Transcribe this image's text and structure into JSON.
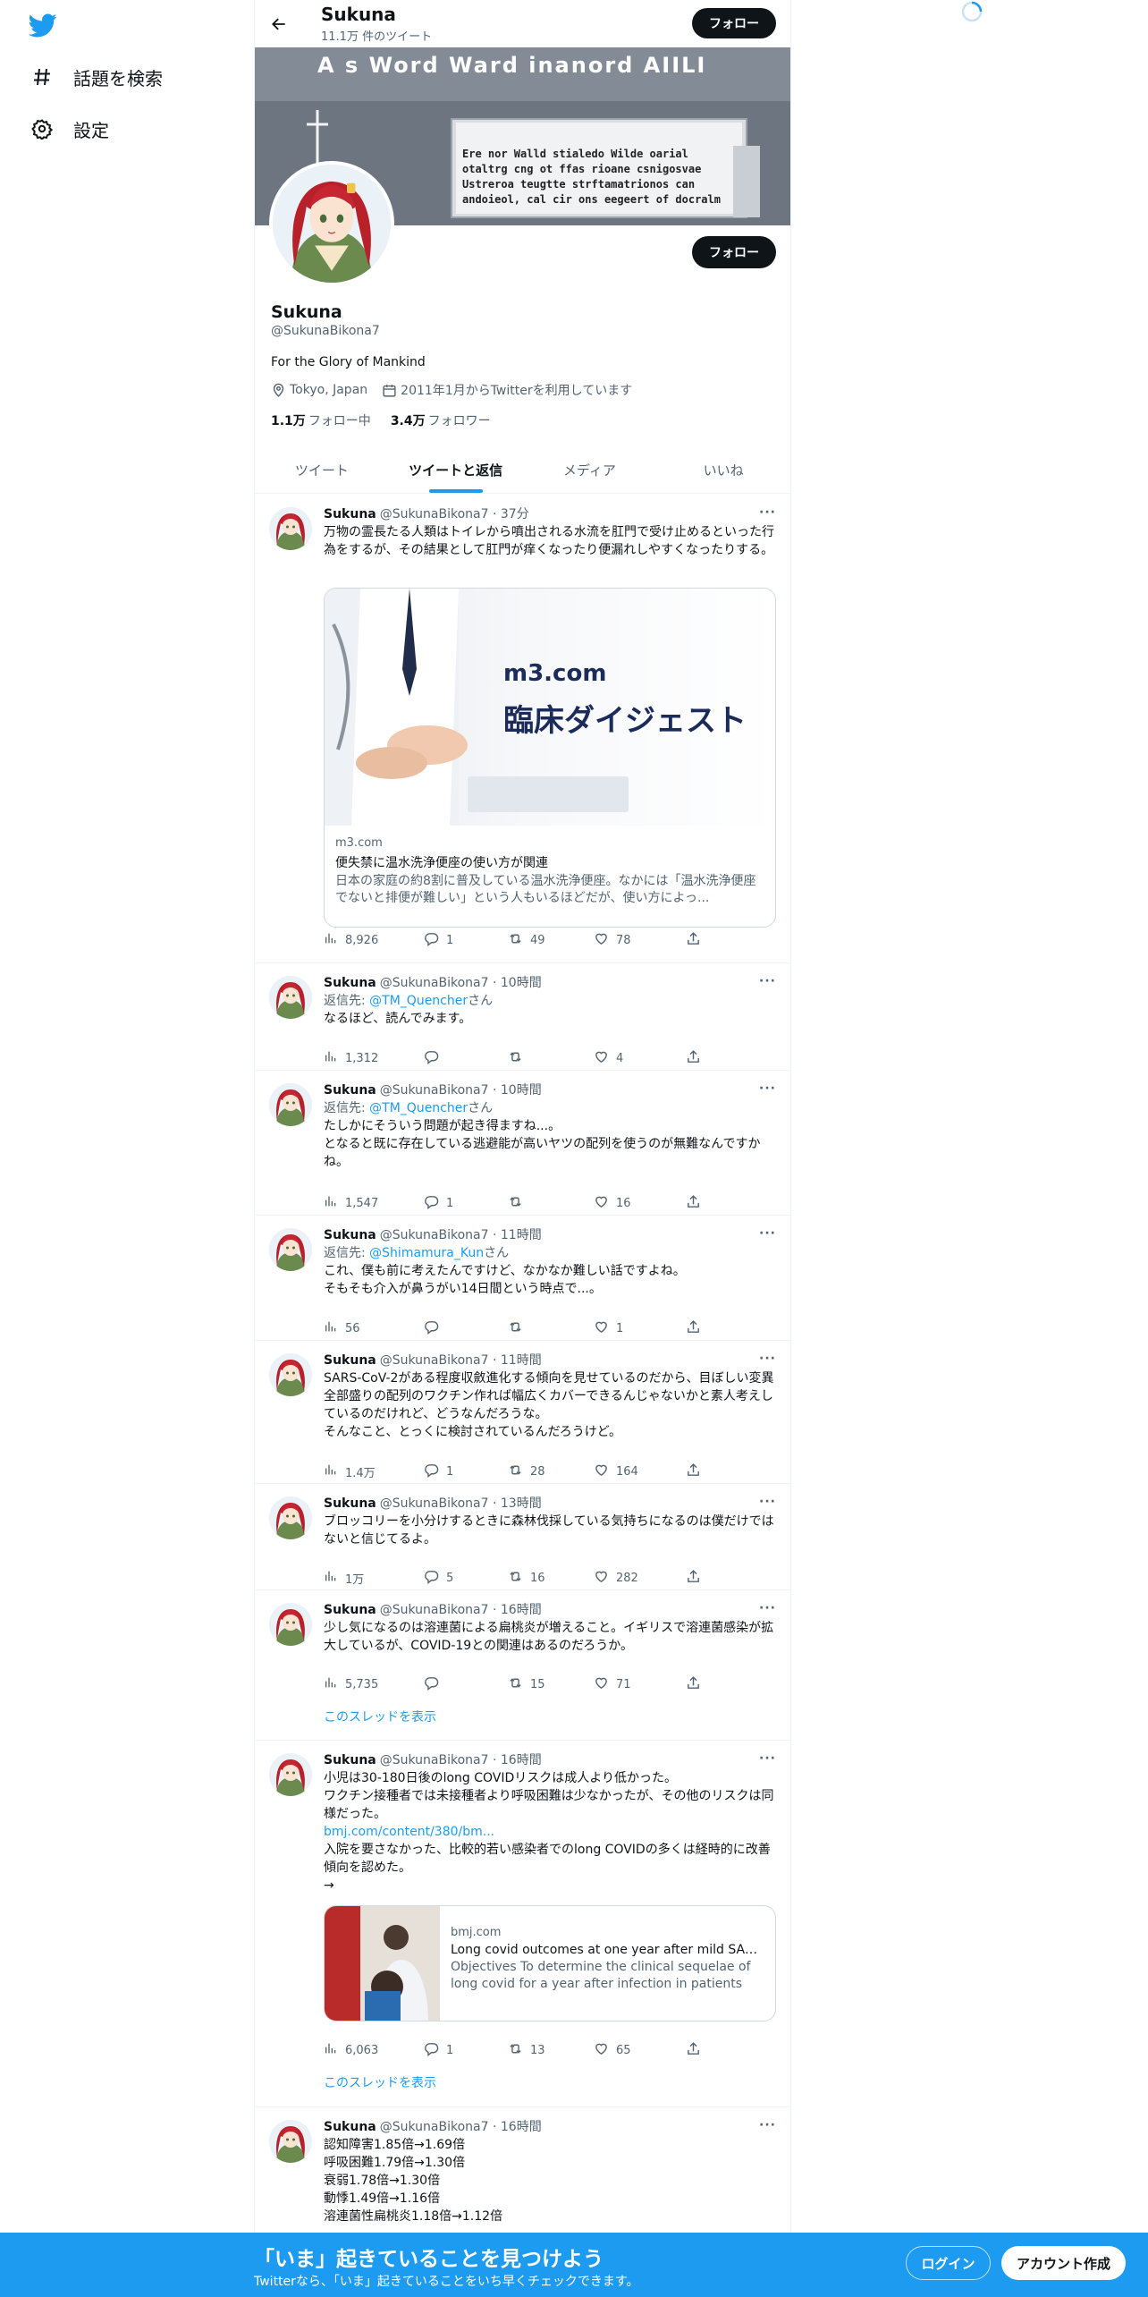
{
  "nav": {
    "explore_label": "話題を検索",
    "settings_label": "設定"
  },
  "header": {
    "name": "Sukuna",
    "tweet_count": "11.1万 件のツイート",
    "follow_label": "フォロー"
  },
  "banner_text": {
    "headline": "A s Word Ward inanord AIILI",
    "board_lines": [
      "Ere nor Walld  stialedo Wilde oarial",
      "otaltrg cng ot ffas rioane csnigosvae",
      "Ustreroa teugtte strftamatrionos can",
      "andoieol, cal cir ons eegeert of docralm"
    ]
  },
  "profile": {
    "name": "Sukuna",
    "handle": "@SukunaBikona7",
    "bio": "For the Glory of Mankind",
    "location": "Tokyo, Japan",
    "joined": "2011年1月からTwitterを利用しています",
    "following_count": "1.1万",
    "following_label": "フォロー中",
    "followers_count": "3.4万",
    "followers_label": "フォロワー",
    "follow_label": "フォロー"
  },
  "tabs": [
    "ツイート",
    "ツイートと返信",
    "メディア",
    "いいね"
  ],
  "tweets": [
    {
      "name": "Sukuna",
      "handle": "@SukunaBikona7",
      "time": "· 37分",
      "reply_to": "",
      "mention": "",
      "suffix": "",
      "text": "万物の霊長たる人類はトイレから噴出される水流を肛門で受け止めるといった行為をするが、その結果として肛門が痒くなったり便漏れしやすくなったりする。",
      "link": "",
      "text2": "",
      "views": "8,926",
      "replies": "1",
      "retweets": "49",
      "likes": "78",
      "card": {
        "domain": "m3.com",
        "title": "便失禁に温水洗浄便座の使い方が関連",
        "desc": "日本の家庭の約8割に普及している温水洗浄便座。なかには「温水洗浄便座でないと排便が難しい」という人もいるほどだが、使い方によっ...",
        "brand": "m3.com",
        "brand_title": "臨床ダイジェスト"
      },
      "thread": ""
    },
    {
      "name": "Sukuna",
      "handle": "@SukunaBikona7",
      "time": "· 10時間",
      "reply_to": "返信先: ",
      "mention": "@TM_Quencher",
      "suffix": "さん",
      "text": "なるほど、読んでみます。",
      "link": "",
      "text2": "",
      "views": "1,312",
      "replies": "",
      "retweets": "",
      "likes": "4",
      "thread": ""
    },
    {
      "name": "Sukuna",
      "handle": "@SukunaBikona7",
      "time": "· 10時間",
      "reply_to": "返信先: ",
      "mention": "@TM_Quencher",
      "suffix": "さん",
      "text": "たしかにそういう問題が起き得ますね...。\nとなると既に存在している逃避能が高いヤツの配列を使うのが無難なんですかね。",
      "link": "",
      "text2": "",
      "views": "1,547",
      "replies": "1",
      "retweets": "",
      "likes": "16",
      "thread": ""
    },
    {
      "name": "Sukuna",
      "handle": "@SukunaBikona7",
      "time": "· 11時間",
      "reply_to": "返信先: ",
      "mention": "@Shimamura_Kun",
      "suffix": "さん",
      "text": "これ、僕も前に考えたんですけど、なかなか難しい話ですよね。\nそもそも介入が鼻うがい14日間という時点で...。",
      "link": "",
      "text2": "",
      "views": "56",
      "replies": "",
      "retweets": "",
      "likes": "1",
      "thread": ""
    },
    {
      "name": "Sukuna",
      "handle": "@SukunaBikona7",
      "time": "· 11時間",
      "reply_to": "",
      "mention": "",
      "suffix": "",
      "text": "SARS-CoV-2がある程度収斂進化する傾向を見せているのだから、目ぼしい変異全部盛りの配列のワクチン作れば幅広くカバーできるんじゃないかと素人考えしているのだけれど、どうなんだろうな。\nそんなこと、とっくに検討されているんだろうけど。",
      "link": "",
      "text2": "",
      "views": "1.4万",
      "replies": "1",
      "retweets": "28",
      "likes": "164",
      "thread": ""
    },
    {
      "name": "Sukuna",
      "handle": "@SukunaBikona7",
      "time": "· 13時間",
      "reply_to": "",
      "mention": "",
      "suffix": "",
      "text": "ブロッコリーを小分けするときに森林伐採している気持ちになるのは僕だけではないと信じてるよ。",
      "link": "",
      "text2": "",
      "views": "1万",
      "replies": "5",
      "retweets": "16",
      "likes": "282",
      "thread": ""
    },
    {
      "name": "Sukuna",
      "handle": "@SukunaBikona7",
      "time": "· 16時間",
      "reply_to": "",
      "mention": "",
      "suffix": "",
      "text": "少し気になるのは溶連菌による扁桃炎が増えること。イギリスで溶連菌感染が拡大しているが、COVID-19との関連はあるのだろうか。",
      "link": "",
      "text2": "",
      "views": "5,735",
      "replies": "",
      "retweets": "15",
      "likes": "71",
      "thread": "このスレッドを表示"
    },
    {
      "name": "Sukuna",
      "handle": "@SukunaBikona7",
      "time": "· 16時間",
      "reply_to": "",
      "mention": "",
      "suffix": "",
      "text": "小児は30-180日後のlong COVIDリスクは成人より低かった。\nワクチン接種者では未接種者より呼吸困難は少なかったが、その他のリスクは同様だった。",
      "link": "bmj.com/content/380/bm...",
      "text2": "入院を要さなかった、比較的若い感染者でのlong COVIDの多くは経時的に改善傾向を認めた。\n→",
      "views": "6,063",
      "replies": "1",
      "retweets": "13",
      "likes": "65",
      "card": {
        "domain": "bmj.com",
        "title": "Long covid outcomes at one year after mild SARS-...",
        "desc": "Objectives To determine the clinical sequelae of long covid for a year after infection in patients with mild ..."
      },
      "thread": "このスレッドを表示"
    },
    {
      "name": "Sukuna",
      "handle": "@SukunaBikona7",
      "time": "· 16時間",
      "reply_to": "",
      "mention": "",
      "suffix": "",
      "text": "認知障害1.85倍→1.69倍\n呼吸困難1.79倍→1.30倍\n衰弱1.78倍→1.30倍\n動悸1.49倍→1.16倍\n溶連菌性扁桃炎1.18倍→1.12倍",
      "link": "",
      "text2": "",
      "views": "",
      "replies": "",
      "retweets": "",
      "likes": "",
      "thread": ""
    }
  ],
  "bottom": {
    "title": "「いま」起きていることを見つけよう",
    "subtitle": "Twitterなら、「いま」起きていることをいち早くチェックできます。",
    "login": "ログイン",
    "signup": "アカウント作成"
  }
}
